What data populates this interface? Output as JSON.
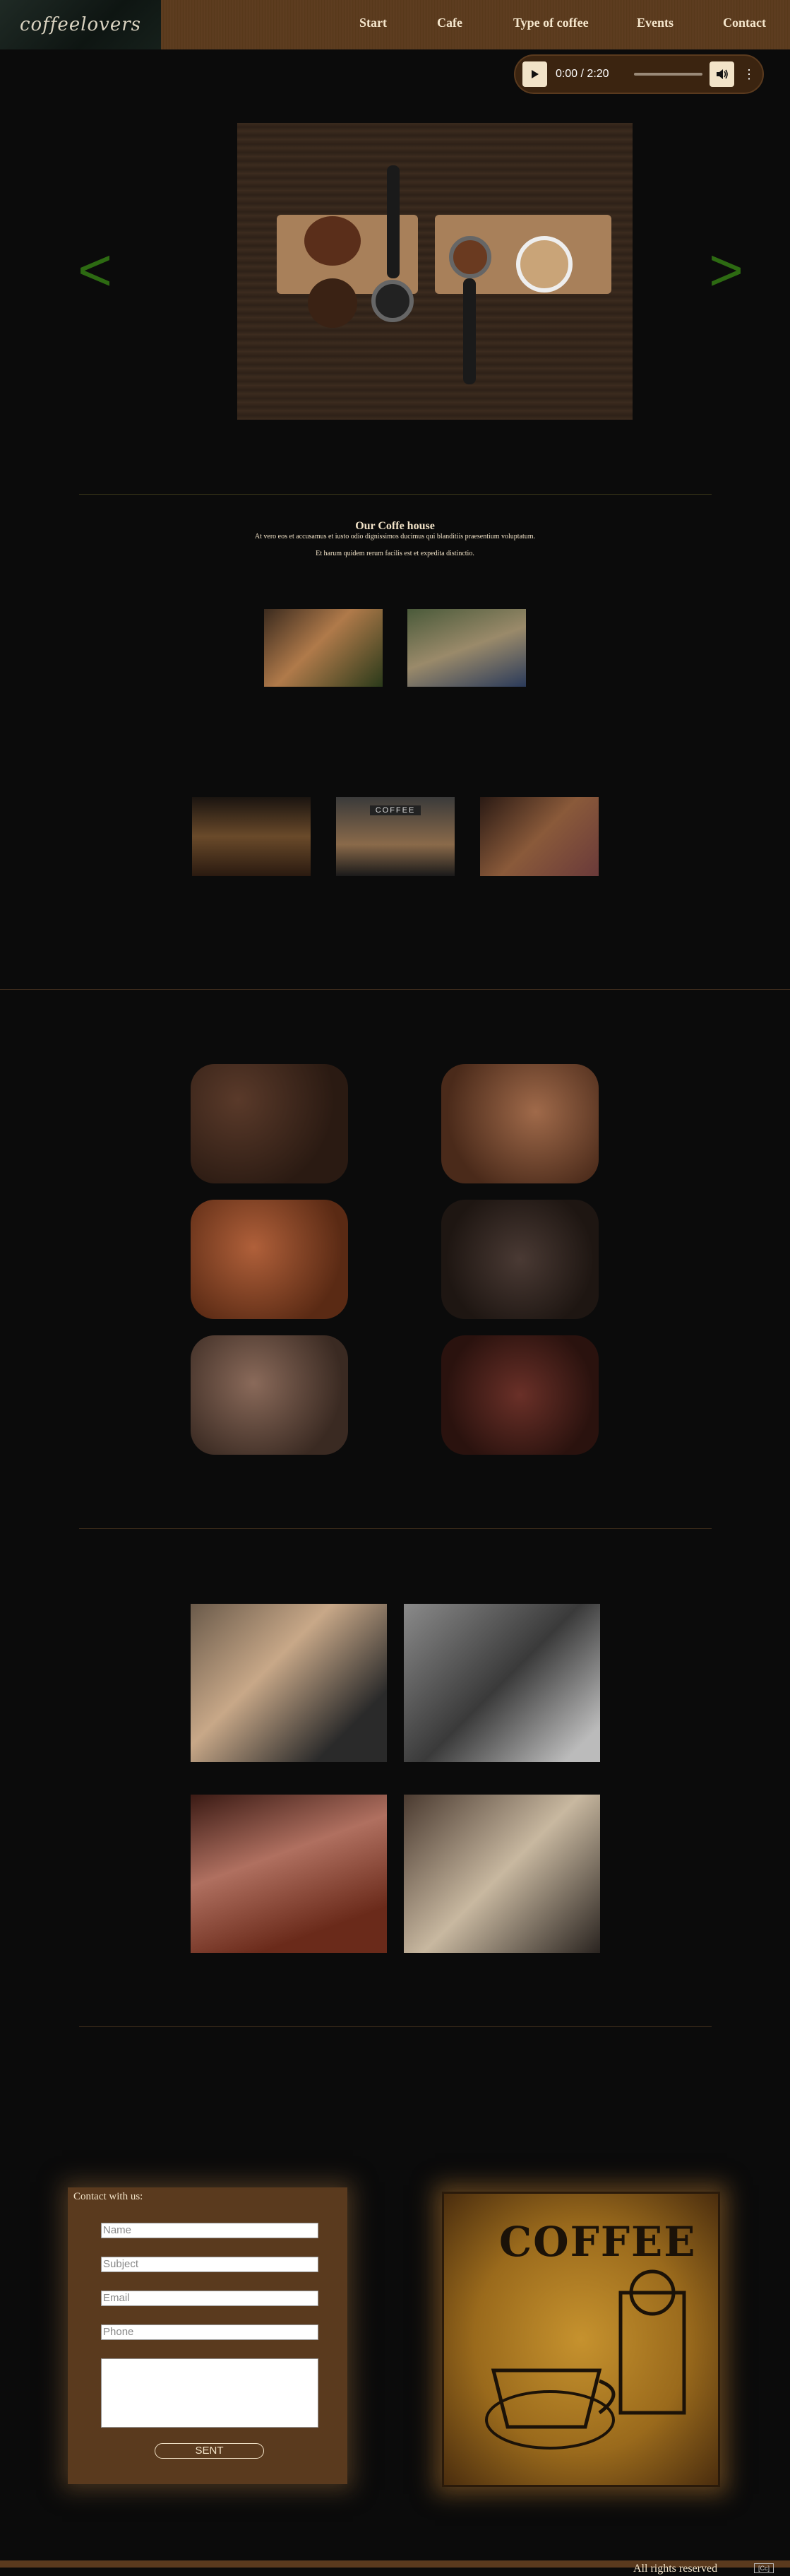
{
  "brand": {
    "logo_text": "coffeelovers"
  },
  "nav": [
    {
      "label": "Start"
    },
    {
      "label": "Cafe"
    },
    {
      "label": "Type of coffee"
    },
    {
      "label": "Events"
    },
    {
      "label": "Contact"
    }
  ],
  "audio": {
    "time": "0:00 / 2:20",
    "play_icon": "play-icon",
    "volume_icon": "volume-icon",
    "menu_icon": "more-vertical-icon"
  },
  "slider": {
    "prev": "<",
    "next": ">"
  },
  "coffee_house": {
    "title": "Our Coffe house",
    "line1": "At vero eos et accusamus et iusto odio dignissimos ducimus qui blanditiis praesentium voluptatum.",
    "line2": "Et harum quidem rerum facilis est et expedita distinctio."
  },
  "contact": {
    "heading": "Contact with us:",
    "name_placeholder": "Name",
    "subject_placeholder": "Subject",
    "email_placeholder": "Email",
    "phone_placeholder": "Phone",
    "send_label": "SENT"
  },
  "poster": {
    "title": "COFFEE"
  },
  "footer": {
    "text": "All rights reserved",
    "badge": "[Cc]"
  },
  "colors": {
    "header_brown": "#5a3a1e",
    "arrow_green": "#2d6a12",
    "background": "#0b0b0b",
    "text_cream": "#f2e3c8"
  }
}
